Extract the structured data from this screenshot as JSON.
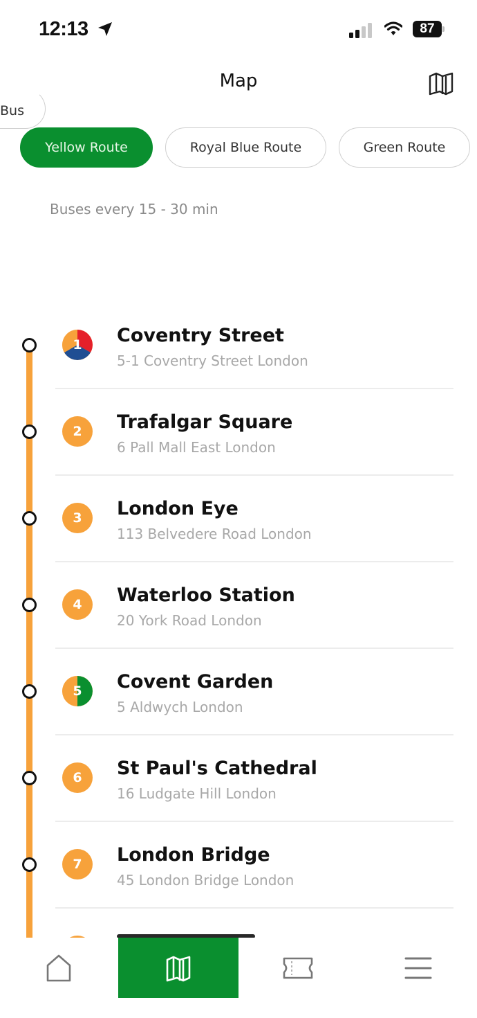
{
  "status_bar": {
    "time": "12:13",
    "battery_percent": "87",
    "location_icon": "location-arrow-icon",
    "signal_icon": "cellular-signal-icon",
    "wifi_icon": "wifi-icon"
  },
  "header": {
    "title": "Map",
    "map_button_icon": "map-icon"
  },
  "route_tabs": [
    {
      "label": "Bus",
      "active": false
    },
    {
      "label": "Yellow Route",
      "active": true
    },
    {
      "label": "Royal Blue Route",
      "active": false
    },
    {
      "label": "Green Route",
      "active": false
    }
  ],
  "frequency_text": "Buses every 15 - 30 min",
  "colors": {
    "accent_green": "#0a8f2f",
    "yellow_route": "#f7a23b",
    "red_route": "#e5202a",
    "blue_route": "#1f4e93",
    "green_route": "#0a8f2f"
  },
  "stops": [
    {
      "number": "1",
      "name": "Coventry Street",
      "address": "5-1 Coventry Street London",
      "routes": [
        "yellow",
        "red",
        "blue"
      ]
    },
    {
      "number": "2",
      "name": "Trafalgar Square",
      "address": "6 Pall Mall East London",
      "routes": [
        "yellow"
      ]
    },
    {
      "number": "3",
      "name": "London Eye",
      "address": "113 Belvedere Road London",
      "routes": [
        "yellow"
      ]
    },
    {
      "number": "4",
      "name": "Waterloo Station",
      "address": "20 York Road London",
      "routes": [
        "yellow"
      ]
    },
    {
      "number": "5",
      "name": "Covent Garden",
      "address": "5 Aldwych London",
      "routes": [
        "yellow",
        "green"
      ]
    },
    {
      "number": "6",
      "name": "St Paul's Cathedral",
      "address": "16 Ludgate Hill London",
      "routes": [
        "yellow"
      ]
    },
    {
      "number": "7",
      "name": "London Bridge",
      "address": "45 London Bridge London",
      "routes": [
        "yellow"
      ]
    }
  ],
  "bottom_nav": [
    {
      "name": "home",
      "icon": "home-icon",
      "active": false
    },
    {
      "name": "map",
      "icon": "map-icon",
      "active": true
    },
    {
      "name": "tickets",
      "icon": "ticket-icon",
      "active": false
    },
    {
      "name": "menu",
      "icon": "hamburger-menu-icon",
      "active": false
    }
  ]
}
